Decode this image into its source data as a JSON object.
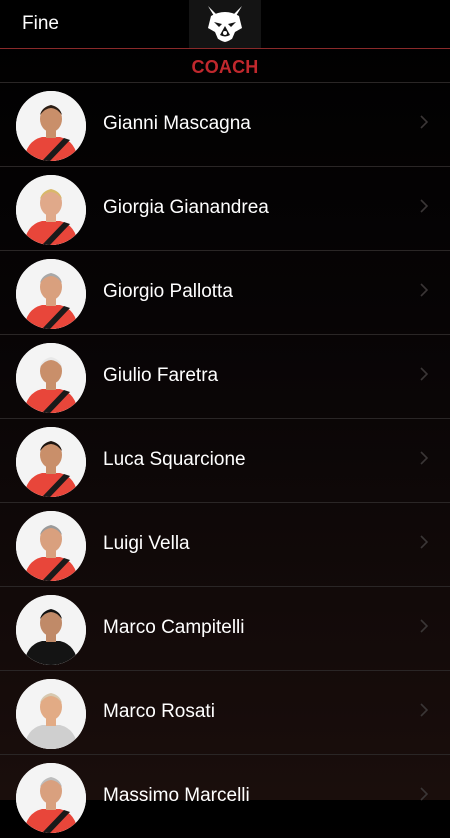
{
  "nav": {
    "done_label": "Fine",
    "logo_icon": "husky-wolf-logo-icon"
  },
  "section": {
    "title": "COACH"
  },
  "colors": {
    "accent": "#c0282d",
    "shirt_red": "#e8463a",
    "divider": "#2a2626"
  },
  "coaches": [
    {
      "name": "Gianni Mascagna",
      "shirt": "red",
      "skin": "#c98f6a",
      "hair": "#2b1d14"
    },
    {
      "name": "Giorgia Gianandrea",
      "shirt": "red",
      "skin": "#e0a98a",
      "hair": "#d8b86a"
    },
    {
      "name": "Giorgio Pallotta",
      "shirt": "red",
      "skin": "#d9a07e",
      "hair": "#a8a8a8"
    },
    {
      "name": "Giulio Faretra",
      "shirt": "red",
      "skin": "#c98f6a",
      "hair": "#e8e8e8"
    },
    {
      "name": "Luca Squarcione",
      "shirt": "red",
      "skin": "#c98f6a",
      "hair": "#1e1510"
    },
    {
      "name": "Luigi Vella",
      "shirt": "red",
      "skin": "#d9a07e",
      "hair": "#9a9a9a"
    },
    {
      "name": "Marco Campitelli",
      "shirt": "black",
      "skin": "#c08a68",
      "hair": "#121212"
    },
    {
      "name": "Marco Rosati",
      "shirt": "other",
      "skin": "#e2ab85",
      "hair": "#d7c9b0"
    },
    {
      "name": "Massimo Marcelli",
      "shirt": "red",
      "skin": "#d9a07e",
      "hair": "#bdbdbd"
    }
  ]
}
